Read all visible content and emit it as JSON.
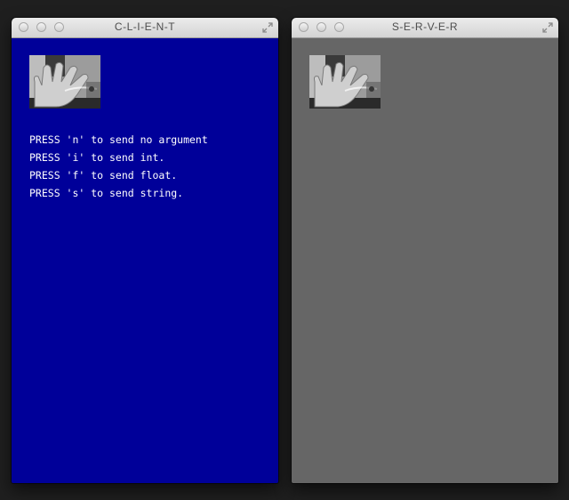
{
  "client_window": {
    "title": "C-L-I-E-N-T",
    "background": "#000099",
    "instructions": [
      "PRESS 'n' to send no argument",
      "PRESS 'i' to send int.",
      "PRESS 'f' to send float.",
      "PRESS 's' to send string."
    ]
  },
  "server_window": {
    "title": "S-E-R-V-E-R",
    "background": "#666666"
  },
  "icons": {
    "window_buttons": [
      "close-icon",
      "minimize-icon",
      "zoom-icon"
    ],
    "fullscreen": "fullscreen-icon",
    "thumbnail": "hand-webcam-image"
  }
}
